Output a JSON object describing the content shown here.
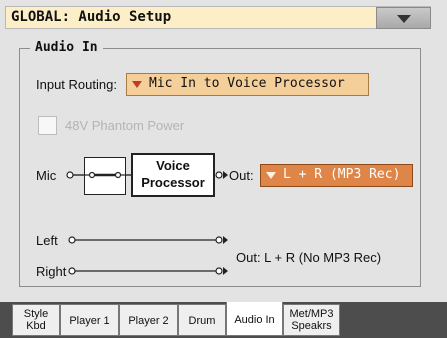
{
  "header": {
    "title": "GLOBAL: Audio Setup",
    "menu_icon": "triangle-down-icon"
  },
  "section": {
    "label": "Audio In"
  },
  "input_routing": {
    "label": "Input Routing:",
    "value": "Mic In to Voice Processor"
  },
  "phantom": {
    "label": "48V Phantom Power",
    "checked": false,
    "enabled": false
  },
  "diagram": {
    "mic_label": "Mic",
    "processor_label_line1": "Voice",
    "processor_label_line2": "Processor",
    "out_label": "Out:",
    "out_value": "L + R (MP3 Rec)",
    "left_label": "Left",
    "right_label": "Right",
    "lr_out_label": "Out: L + R (No MP3 Rec)"
  },
  "tabs": [
    {
      "label": "Style\nKbd",
      "active": false
    },
    {
      "label": "Player 1",
      "active": false
    },
    {
      "label": "Player 2",
      "active": false
    },
    {
      "label": "Drum",
      "active": false
    },
    {
      "label": "Audio In",
      "active": true
    },
    {
      "label": "Met/MP3\nSpeakrs",
      "active": false
    }
  ],
  "colors": {
    "title_bg": "#fcefc7",
    "dropdown_bg": "#f5cf9a",
    "dropdown_selected_bg": "#de8547",
    "panel_bg": "#e3e3e3"
  }
}
